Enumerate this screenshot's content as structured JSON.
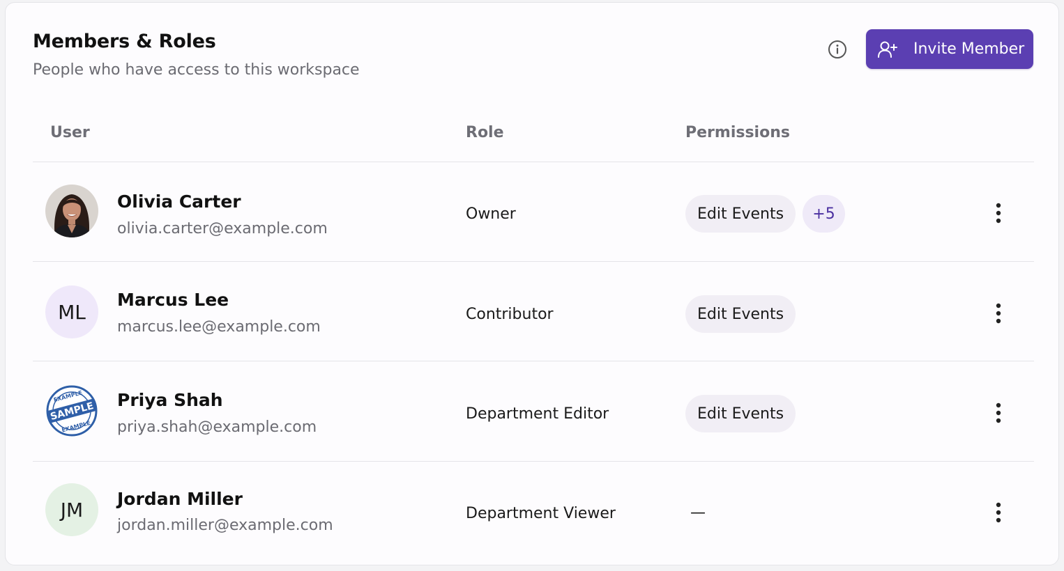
{
  "header": {
    "title": "Members & Roles",
    "subtitle": "People who have access to this workspace",
    "info_icon": "info-icon",
    "invite_button_label": "Invite Member",
    "invite_icon": "user-plus-icon"
  },
  "table": {
    "columns": [
      "User",
      "Role",
      "Permissions"
    ],
    "rows": [
      {
        "name": "Olivia Carter",
        "email": "olivia.carter@example.com",
        "avatar_type": "photo",
        "initials": "",
        "role": "Owner",
        "permission": "Edit Events",
        "extra_permissions": "+5"
      },
      {
        "name": "Marcus Lee",
        "email": "marcus.lee@example.com",
        "avatar_type": "initials",
        "initials": "ML",
        "avatar_color": "#efe8fa",
        "role": "Contributor",
        "permission": "Edit Events",
        "extra_permissions": ""
      },
      {
        "name": "Priya Shah",
        "email": "priya.shah@example.com",
        "avatar_type": "sample-stamp",
        "initials": "",
        "stamp_text": "SAMPLE",
        "stamp_ring_text": "EXAMPLE",
        "role": "Department Editor",
        "permission": "Edit Events",
        "extra_permissions": ""
      },
      {
        "name": "Jordan Miller",
        "email": "jordan.miller@example.com",
        "avatar_type": "initials",
        "initials": "JM",
        "avatar_color": "#e4f1e4",
        "role": "Department Viewer",
        "permission": "—",
        "extra_permissions": ""
      }
    ]
  },
  "colors": {
    "accent": "#5b3fb2",
    "chip_bg": "#f1eef5",
    "more_chip_text": "#4a2fa0"
  }
}
